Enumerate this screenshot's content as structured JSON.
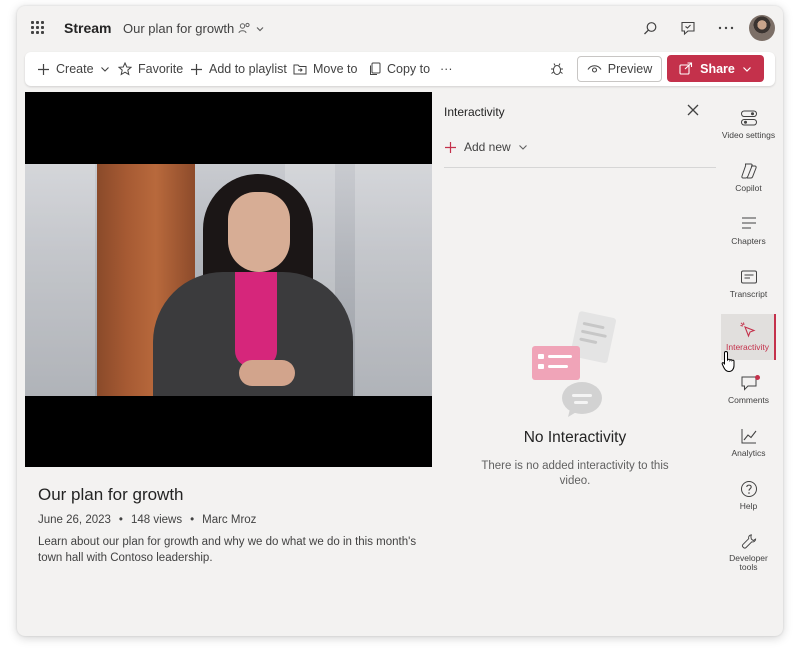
{
  "header": {
    "app_name": "Stream",
    "doc_title": "Our plan for growth"
  },
  "toolbar": {
    "create": "Create",
    "favorite": "Favorite",
    "add_to_playlist": "Add to playlist",
    "move_to": "Move to",
    "copy_to": "Copy to",
    "more": "···",
    "preview": "Preview",
    "share": "Share"
  },
  "video": {
    "title": "Our plan for growth",
    "date": "June 26, 2023",
    "views": "148 views",
    "author": "Marc Mroz",
    "separator": "•",
    "description": "Learn about our plan for growth and why we do what we do in this month's town hall with Contoso leadership."
  },
  "panel": {
    "title": "Interactivity",
    "add_new": "Add new",
    "empty_title": "No Interactivity",
    "empty_desc": "There is no added interactivity to this video."
  },
  "rail": {
    "items": [
      {
        "label": "Video settings",
        "icon": "video-settings-icon"
      },
      {
        "label": "Copilot",
        "icon": "copilot-icon"
      },
      {
        "label": "Chapters",
        "icon": "chapters-icon"
      },
      {
        "label": "Transcript",
        "icon": "transcript-icon"
      },
      {
        "label": "Interactivity",
        "icon": "interactivity-icon",
        "active": true
      },
      {
        "label": "Comments",
        "icon": "comments-icon"
      },
      {
        "label": "Analytics",
        "icon": "analytics-icon"
      },
      {
        "label": "Help",
        "icon": "help-icon"
      },
      {
        "label": "Developer tools",
        "icon": "developer-tools-icon"
      }
    ]
  },
  "colors": {
    "accent": "#c4314b",
    "background": "#f3f2f1",
    "video_bg": "#000000"
  }
}
